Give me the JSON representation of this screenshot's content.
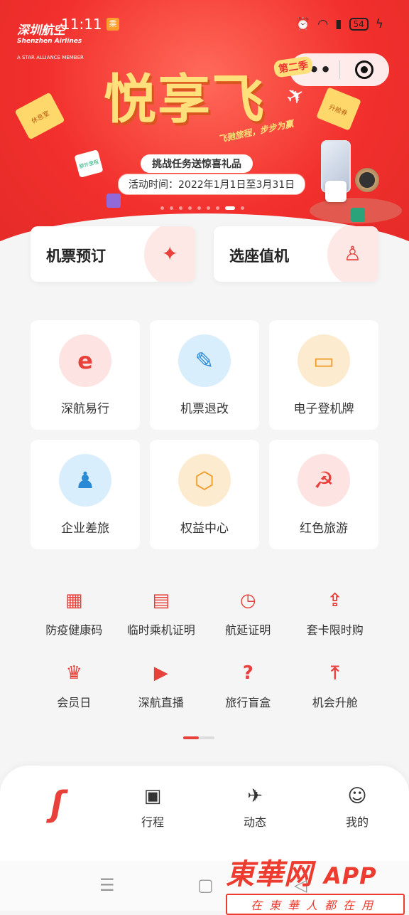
{
  "status_bar": {
    "time": "11:11",
    "badge": "乘",
    "battery": "54"
  },
  "banner": {
    "logo_cn": "深圳航空",
    "logo_en": "Shenzhen Airlines",
    "logo_alliance": "A STAR ALLIANCE MEMBER",
    "title": "悦享飞",
    "season": "第二季",
    "slogan": "飞驰旅程，步步为赢",
    "challenge": "挑战任务送惊喜礼品",
    "period": "活动时间：2022年1月1日至3月31日",
    "ticket_left": "休息室",
    "ticket_right": "升舱券",
    "ticket_small": "额外里程"
  },
  "quick_actions": [
    {
      "label": "机票预订",
      "icon": "ticket-icon"
    },
    {
      "label": "选座值机",
      "icon": "seat-icon"
    }
  ],
  "services": [
    {
      "label": "深航易行",
      "icon": "e-travel-icon",
      "color": "red",
      "glyph": "e"
    },
    {
      "label": "机票退改",
      "icon": "ticket-edit-icon",
      "color": "blue",
      "glyph": "✎"
    },
    {
      "label": "电子登机牌",
      "icon": "boarding-pass-icon",
      "color": "orange",
      "glyph": "▭"
    },
    {
      "label": "企业差旅",
      "icon": "business-traveler-icon",
      "color": "blue",
      "glyph": "♟"
    },
    {
      "label": "权益中心",
      "icon": "benefits-badge-icon",
      "color": "orange",
      "glyph": "⬡"
    },
    {
      "label": "红色旅游",
      "icon": "hammer-sickle-icon",
      "color": "red",
      "glyph": "☭"
    }
  ],
  "more_services": [
    {
      "label": "防疫健康码",
      "icon": "qr-code-icon",
      "glyph": "▦"
    },
    {
      "label": "临时乘机证明",
      "icon": "id-card-icon",
      "glyph": "▤"
    },
    {
      "label": "航延证明",
      "icon": "clock-icon",
      "glyph": "◷"
    },
    {
      "label": "套卡限时购",
      "icon": "card-upload-icon",
      "glyph": "⇪"
    },
    {
      "label": "会员日",
      "icon": "calendar-crown-icon",
      "glyph": "♛"
    },
    {
      "label": "深航直播",
      "icon": "video-camera-icon",
      "glyph": "▶"
    },
    {
      "label": "旅行盲盒",
      "icon": "mystery-box-icon",
      "glyph": "?"
    },
    {
      "label": "机会升舱",
      "icon": "seat-upgrade-icon",
      "glyph": "⤒"
    }
  ],
  "tabbar": [
    {
      "label": "",
      "icon": "shenzhen-airlines-logo-icon"
    },
    {
      "label": "行程",
      "icon": "briefcase-icon"
    },
    {
      "label": "动态",
      "icon": "plane-takeoff-icon"
    },
    {
      "label": "我的",
      "icon": "user-icon"
    }
  ],
  "watermark": {
    "brand": "東華网",
    "app": "APP",
    "tagline": "在東華人都在用"
  },
  "colors": {
    "primary": "#e8403a",
    "banner": "#f2302d",
    "gold": "#ffe07a"
  }
}
